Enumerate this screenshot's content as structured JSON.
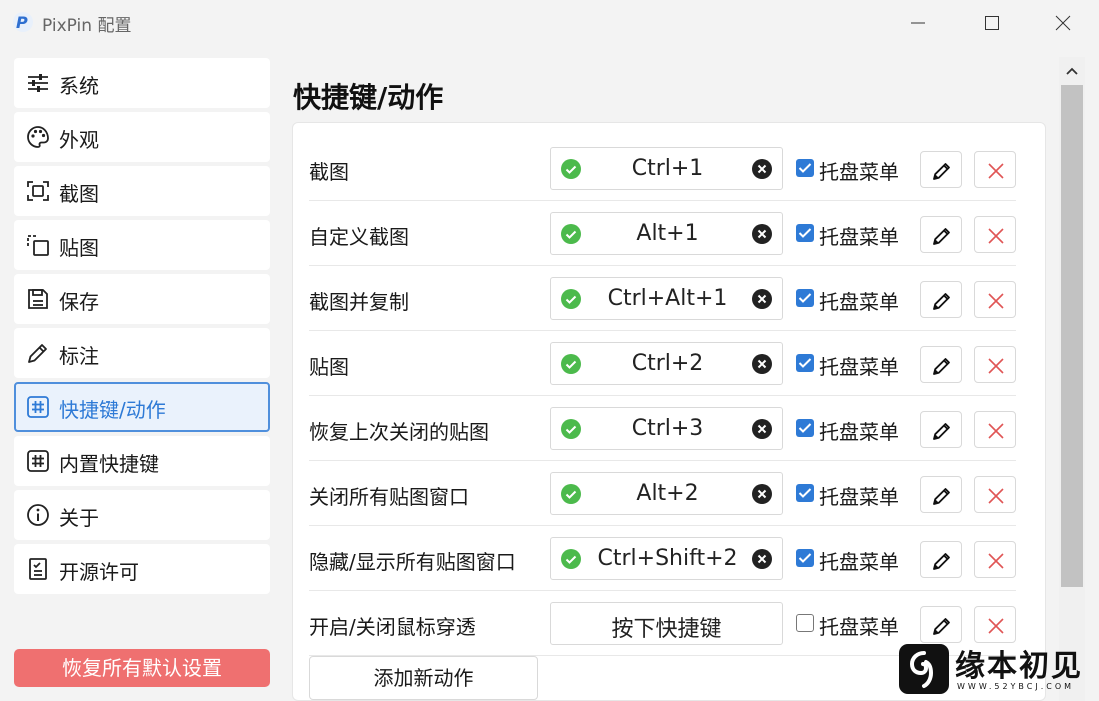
{
  "window": {
    "title": "PixPin 配置",
    "minimize_icon": "minimize-icon",
    "maximize_icon": "maximize-icon",
    "close_icon": "close-icon"
  },
  "sidebar": {
    "items": [
      {
        "label": "系统",
        "icon": "sliders-icon",
        "active": false
      },
      {
        "label": "外观",
        "icon": "palette-icon",
        "active": false
      },
      {
        "label": "截图",
        "icon": "screenshot-icon",
        "active": false
      },
      {
        "label": "贴图",
        "icon": "pin-image-icon",
        "active": false
      },
      {
        "label": "保存",
        "icon": "save-icon",
        "active": false
      },
      {
        "label": "标注",
        "icon": "pencil-icon",
        "active": false
      },
      {
        "label": "快捷键/动作",
        "icon": "hash-icon",
        "active": true
      },
      {
        "label": "内置快捷键",
        "icon": "hash-icon",
        "active": false
      },
      {
        "label": "关于",
        "icon": "info-icon",
        "active": false
      },
      {
        "label": "开源许可",
        "icon": "license-icon",
        "active": false
      }
    ],
    "reset_label": "恢复所有默认设置"
  },
  "main": {
    "title": "快捷键/动作",
    "rows": [
      {
        "label": "截图",
        "hotkey": "Ctrl+1",
        "set": true,
        "tray_label": "托盘菜单",
        "tray": true
      },
      {
        "label": "自定义截图",
        "hotkey": "Alt+1",
        "set": true,
        "tray_label": "托盘菜单",
        "tray": true
      },
      {
        "label": "截图并复制",
        "hotkey": "Ctrl+Alt+1",
        "set": true,
        "tray_label": "托盘菜单",
        "tray": true
      },
      {
        "label": "贴图",
        "hotkey": "Ctrl+2",
        "set": true,
        "tray_label": "托盘菜单",
        "tray": true
      },
      {
        "label": "恢复上次关闭的贴图",
        "hotkey": "Ctrl+3",
        "set": true,
        "tray_label": "托盘菜单",
        "tray": true
      },
      {
        "label": "关闭所有贴图窗口",
        "hotkey": "Alt+2",
        "set": true,
        "tray_label": "托盘菜单",
        "tray": true
      },
      {
        "label": "隐藏/显示所有贴图窗口",
        "hotkey": "Ctrl+Shift+2",
        "set": true,
        "tray_label": "托盘菜单",
        "tray": true
      },
      {
        "label": "开启/关闭鼠标穿透",
        "hotkey": "按下快捷键",
        "set": false,
        "tray_label": "托盘菜单",
        "tray": false
      }
    ],
    "add_label": "添加新动作"
  },
  "watermark": {
    "text": "缘本初见",
    "url": "WWW.52YBCJ.COM"
  },
  "colors": {
    "accent": "#2e7ad6",
    "danger": "#ef7070",
    "success": "#4cba4c"
  }
}
